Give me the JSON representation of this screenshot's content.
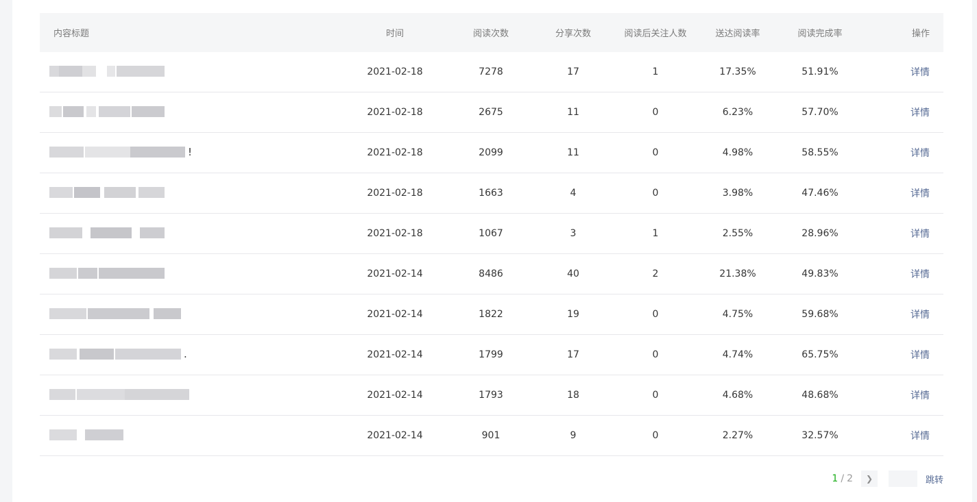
{
  "table": {
    "headers": {
      "title": "内容标题",
      "date": "时间",
      "reads": "阅读次数",
      "shares": "分享次数",
      "follows": "阅读后关注人数",
      "delivery_rate": "送达阅读率",
      "completion_rate": "阅读完成率",
      "action": "操作"
    },
    "rows": [
      {
        "title_suffix": "",
        "date": "2021-02-18",
        "reads": "7278",
        "shares": "17",
        "follows": "1",
        "delivery_rate": "17.35%",
        "completion_rate": "51.91%",
        "action": "详情"
      },
      {
        "title_suffix": "",
        "date": "2021-02-18",
        "reads": "2675",
        "shares": "11",
        "follows": "0",
        "delivery_rate": "6.23%",
        "completion_rate": "57.70%",
        "action": "详情"
      },
      {
        "title_suffix": "!",
        "date": "2021-02-18",
        "reads": "2099",
        "shares": "11",
        "follows": "0",
        "delivery_rate": "4.98%",
        "completion_rate": "58.55%",
        "action": "详情"
      },
      {
        "title_suffix": "",
        "date": "2021-02-18",
        "reads": "1663",
        "shares": "4",
        "follows": "0",
        "delivery_rate": "3.98%",
        "completion_rate": "47.46%",
        "action": "详情"
      },
      {
        "title_suffix": "",
        "date": "2021-02-18",
        "reads": "1067",
        "shares": "3",
        "follows": "1",
        "delivery_rate": "2.55%",
        "completion_rate": "28.96%",
        "action": "详情"
      },
      {
        "title_suffix": "",
        "date": "2021-02-14",
        "reads": "8486",
        "shares": "40",
        "follows": "2",
        "delivery_rate": "21.38%",
        "completion_rate": "49.83%",
        "action": "详情"
      },
      {
        "title_suffix": "",
        "date": "2021-02-14",
        "reads": "1822",
        "shares": "19",
        "follows": "0",
        "delivery_rate": "4.75%",
        "completion_rate": "59.68%",
        "action": "详情"
      },
      {
        "title_suffix": ".",
        "date": "2021-02-14",
        "reads": "1799",
        "shares": "17",
        "follows": "0",
        "delivery_rate": "4.74%",
        "completion_rate": "65.75%",
        "action": "详情"
      },
      {
        "title_suffix": "",
        "date": "2021-02-14",
        "reads": "1793",
        "shares": "18",
        "follows": "0",
        "delivery_rate": "4.68%",
        "completion_rate": "48.68%",
        "action": "详情"
      },
      {
        "title_suffix": "",
        "date": "2021-02-14",
        "reads": "901",
        "shares": "9",
        "follows": "0",
        "delivery_rate": "2.27%",
        "completion_rate": "32.57%",
        "action": "详情"
      }
    ]
  },
  "pagination": {
    "current": "1",
    "separator": "/",
    "total": "2",
    "next_icon": "chevron-right-icon",
    "jump_value": "",
    "jump_label": "跳转"
  },
  "colors": {
    "accent": "#1aad19",
    "link": "#576b95",
    "header_bg": "#f5f6f7",
    "page_bg": "#f4f5f7"
  }
}
